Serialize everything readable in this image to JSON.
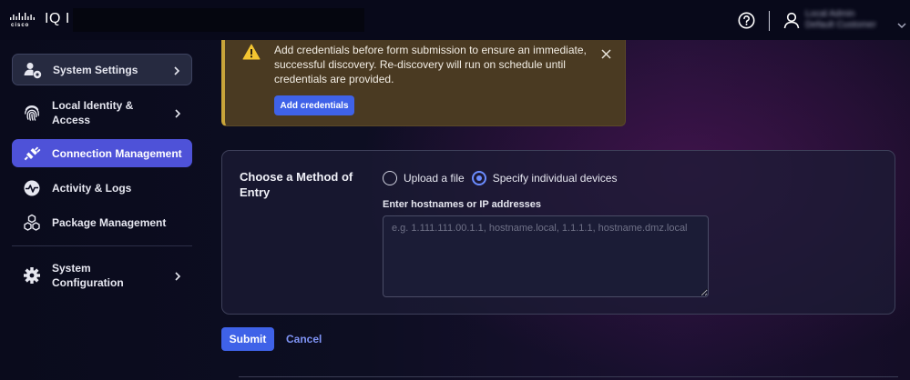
{
  "header": {
    "logo_text": "cisco",
    "app_name": "IQ I",
    "user_name": "Local Admin",
    "user_org": "Default Customer"
  },
  "sidebar": {
    "items": [
      {
        "label": "System Settings",
        "icon": "settings-user-icon"
      },
      {
        "label": "Local Identity & Access",
        "icon": "fingerprint-icon"
      },
      {
        "label": "Connection Management",
        "icon": "plug-icon"
      },
      {
        "label": "Activity & Logs",
        "icon": "activity-icon"
      },
      {
        "label": "Package Management",
        "icon": "package-icon"
      },
      {
        "label": "System Configuration",
        "icon": "gear-icon"
      }
    ],
    "active_index": 2
  },
  "alert": {
    "message": "Add credentials before form submission to ensure an immediate, successful discovery. Re-discovery will run on schedule until credentials are provided.",
    "button_label": "Add credentials"
  },
  "form": {
    "title": "Choose a Method of Entry",
    "options": [
      "Upload a file",
      "Specify individual devices"
    ],
    "selected_option": "Specify individual devices",
    "field_label": "Enter hostnames or IP addresses",
    "placeholder": "e.g. 1.111.111.00.1.1, hostname.local, 1.1.1.1, hostname.dmz.local",
    "value": ""
  },
  "actions": {
    "submit_label": "Submit",
    "cancel_label": "Cancel"
  },
  "colors": {
    "accent": "#3f62e8",
    "active_nav": "#4e52d8",
    "warning": "#c8a43a",
    "link": "#7e93f5"
  }
}
